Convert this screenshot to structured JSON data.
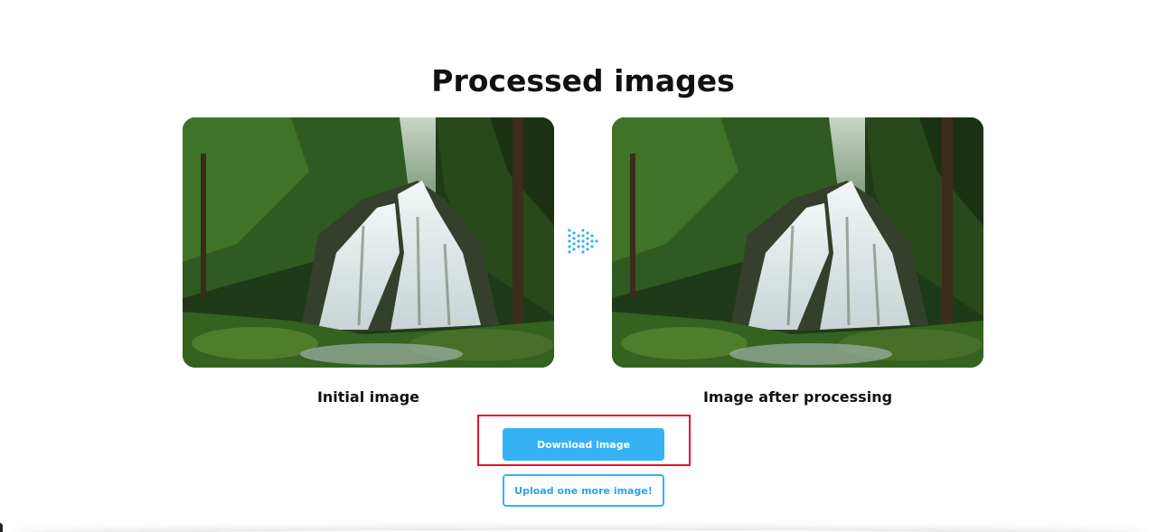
{
  "page": {
    "title": "Processed images"
  },
  "images": {
    "initial_caption": "Initial image",
    "processed_caption": "Image after processing"
  },
  "actions": {
    "download_label": "Download image",
    "upload_more_label": "Upload one more image!"
  },
  "colors": {
    "accent": "#36b1f3",
    "highlight": "#e8102a",
    "text": "#111111"
  },
  "icons": {
    "transition": "double-chevron-arrow-icon"
  }
}
